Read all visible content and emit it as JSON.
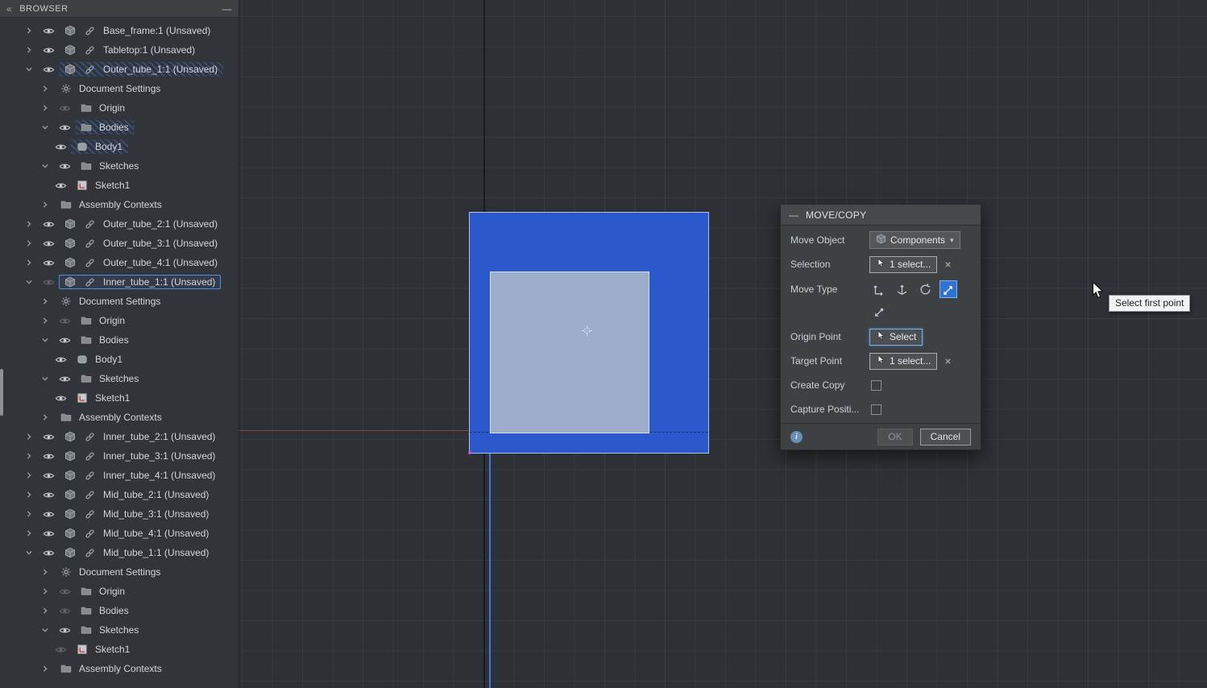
{
  "colors": {
    "selection_blue": "#2b59cc",
    "body_face": "#9dadcc",
    "accent_blue": "#4f8de0",
    "viewport_bg": "#2d3034"
  },
  "icons": {
    "collapse_panel": "«",
    "minimize": "—",
    "dialog_collapse": "—",
    "caret_down": "▾",
    "clear": "×",
    "info": "i"
  },
  "browser": {
    "title": "BROWSER",
    "items": [
      {
        "indent": 0,
        "chevron": "right",
        "eye": "on",
        "icon": "component",
        "link": true,
        "label": "Base_frame:1 (Unsaved)"
      },
      {
        "indent": 0,
        "chevron": "right",
        "eye": "on",
        "icon": "component",
        "link": true,
        "label": "Tabletop:1 (Unsaved)"
      },
      {
        "indent": 0,
        "chevron": "down",
        "eye": "on",
        "icon": "component",
        "link": true,
        "label": "Outer_tube_1:1 (Unsaved)",
        "state": "hatched"
      },
      {
        "indent": 1,
        "chevron": "right",
        "eye": "none",
        "icon": "gear",
        "link": false,
        "label": "Document Settings"
      },
      {
        "indent": 1,
        "chevron": "right",
        "eye": "off",
        "icon": "folder",
        "link": false,
        "label": "Origin"
      },
      {
        "indent": 1,
        "chevron": "down",
        "eye": "on",
        "icon": "folder",
        "link": false,
        "label": "Bodies",
        "state": "hatched"
      },
      {
        "indent": 2,
        "chevron": "none",
        "eye": "on",
        "icon": "body",
        "link": false,
        "label": "Body1",
        "state": "hatched"
      },
      {
        "indent": 1,
        "chevron": "down",
        "eye": "on",
        "icon": "folder",
        "link": false,
        "label": "Sketches"
      },
      {
        "indent": 2,
        "chevron": "none",
        "eye": "on",
        "icon": "sketch",
        "link": false,
        "label": "Sketch1"
      },
      {
        "indent": 1,
        "chevron": "right",
        "eye": "none",
        "icon": "folder",
        "link": false,
        "label": "Assembly Contexts"
      },
      {
        "indent": 0,
        "chevron": "right",
        "eye": "on",
        "icon": "component",
        "link": true,
        "label": "Outer_tube_2:1 (Unsaved)"
      },
      {
        "indent": 0,
        "chevron": "right",
        "eye": "on",
        "icon": "component",
        "link": true,
        "label": "Outer_tube_3:1 (Unsaved)"
      },
      {
        "indent": 0,
        "chevron": "right",
        "eye": "on",
        "icon": "component",
        "link": true,
        "label": "Outer_tube_4:1 (Unsaved)"
      },
      {
        "indent": 0,
        "chevron": "down",
        "eye": "off",
        "icon": "component",
        "link": true,
        "label": "Inner_tube_1:1 (Unsaved)",
        "state": "selected"
      },
      {
        "indent": 1,
        "chevron": "right",
        "eye": "none",
        "icon": "gear",
        "link": false,
        "label": "Document Settings"
      },
      {
        "indent": 1,
        "chevron": "right",
        "eye": "off",
        "icon": "folder",
        "link": false,
        "label": "Origin"
      },
      {
        "indent": 1,
        "chevron": "down",
        "eye": "on",
        "icon": "folder",
        "link": false,
        "label": "Bodies"
      },
      {
        "indent": 2,
        "chevron": "none",
        "eye": "on",
        "icon": "body",
        "link": false,
        "label": "Body1"
      },
      {
        "indent": 1,
        "chevron": "down",
        "eye": "on",
        "icon": "folder",
        "link": false,
        "label": "Sketches"
      },
      {
        "indent": 2,
        "chevron": "none",
        "eye": "on",
        "icon": "sketch",
        "link": false,
        "label": "Sketch1"
      },
      {
        "indent": 1,
        "chevron": "right",
        "eye": "none",
        "icon": "folder",
        "link": false,
        "label": "Assembly Contexts"
      },
      {
        "indent": 0,
        "chevron": "right",
        "eye": "on",
        "icon": "component",
        "link": true,
        "label": "Inner_tube_2:1 (Unsaved)"
      },
      {
        "indent": 0,
        "chevron": "right",
        "eye": "on",
        "icon": "component",
        "link": true,
        "label": "Inner_tube_3:1 (Unsaved)"
      },
      {
        "indent": 0,
        "chevron": "right",
        "eye": "on",
        "icon": "component",
        "link": true,
        "label": "Inner_tube_4:1 (Unsaved)"
      },
      {
        "indent": 0,
        "chevron": "right",
        "eye": "on",
        "icon": "component",
        "link": true,
        "label": "Mid_tube_2:1 (Unsaved)"
      },
      {
        "indent": 0,
        "chevron": "right",
        "eye": "on",
        "icon": "component",
        "link": true,
        "label": "Mid_tube_3:1 (Unsaved)"
      },
      {
        "indent": 0,
        "chevron": "right",
        "eye": "on",
        "icon": "component",
        "link": true,
        "label": "Mid_tube_4:1 (Unsaved)"
      },
      {
        "indent": 0,
        "chevron": "down",
        "eye": "on",
        "icon": "component",
        "link": true,
        "label": "Mid_tube_1:1 (Unsaved)"
      },
      {
        "indent": 1,
        "chevron": "right",
        "eye": "none",
        "icon": "gear",
        "link": false,
        "label": "Document Settings"
      },
      {
        "indent": 1,
        "chevron": "right",
        "eye": "off",
        "icon": "folder",
        "link": false,
        "label": "Origin"
      },
      {
        "indent": 1,
        "chevron": "right",
        "eye": "off",
        "icon": "folder",
        "link": false,
        "label": "Bodies"
      },
      {
        "indent": 1,
        "chevron": "down",
        "eye": "on",
        "icon": "folder",
        "link": false,
        "label": "Sketches"
      },
      {
        "indent": 2,
        "chevron": "none",
        "eye": "off",
        "icon": "sketch",
        "link": false,
        "label": "Sketch1"
      },
      {
        "indent": 1,
        "chevron": "right",
        "eye": "none",
        "icon": "folder",
        "link": false,
        "label": "Assembly Contexts"
      }
    ]
  },
  "dialog": {
    "title": "MOVE/COPY",
    "move_object": {
      "label": "Move Object",
      "value": "Components"
    },
    "selection": {
      "label": "Selection",
      "value": "1 select..."
    },
    "move_type": {
      "label": "Move Type",
      "options": [
        "translate",
        "free-move",
        "rotate",
        "point-to-point",
        "point-to-position"
      ],
      "selected": "point-to-point"
    },
    "origin_point": {
      "label": "Origin Point",
      "value": "Select"
    },
    "target_point": {
      "label": "Target Point",
      "value": "1 select..."
    },
    "create_copy": {
      "label": "Create Copy",
      "checked": false
    },
    "capture_position": {
      "label": "Capture Positi...",
      "checked": false
    },
    "ok_label": "OK",
    "ok_enabled": false,
    "cancel_label": "Cancel"
  },
  "tooltip": {
    "text": "Select first point"
  }
}
